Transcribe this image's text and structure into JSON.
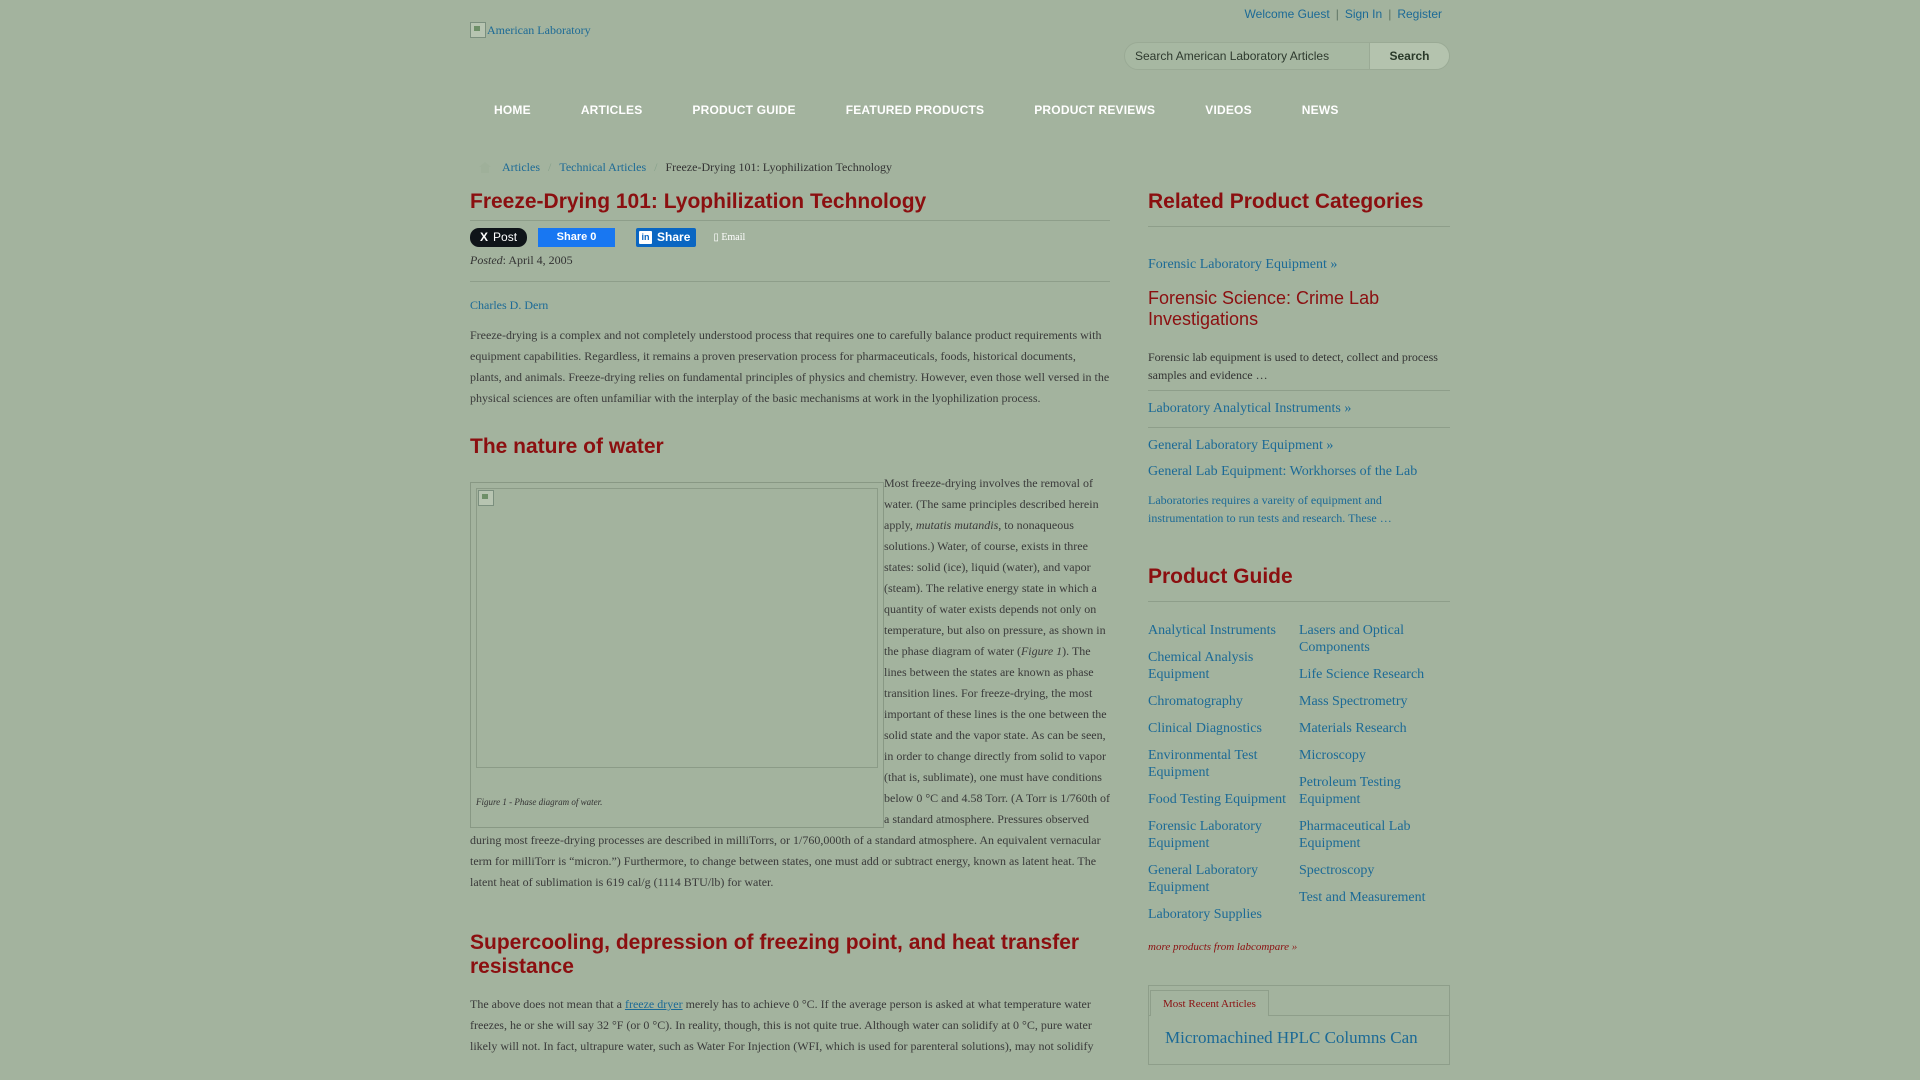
{
  "header": {
    "welcome": "Welcome Guest",
    "sign_in": "Sign In",
    "register": "Register",
    "logo_alt": "American Laboratory",
    "search_placeholder": "Search American Laboratory Articles",
    "search_button": "Search"
  },
  "nav": [
    "HOME",
    "ARTICLES",
    "PRODUCT GUIDE",
    "FEATURED PRODUCTS",
    "PRODUCT REVIEWS",
    "VIDEOS",
    "NEWS"
  ],
  "breadcrumb": {
    "items": [
      "Articles",
      "Technical Articles"
    ],
    "current": "Freeze-Drying 101: Lyophilization Technology"
  },
  "article": {
    "title": "Freeze-Drying 101: Lyophilization Technology",
    "share": {
      "x_post": "Post",
      "fb_share": "Share 0",
      "li_share": "Share",
      "email": "Email"
    },
    "posted_label": "Posted",
    "posted_date": ": April 4, 2005",
    "author": "Charles D. Dern",
    "intro": "Freeze-drying is a complex and not completely understood process that requires one to carefully balance product requirements with equipment capabilities. Regardless, it remains a proven preservation process for pharmaceuticals, foods, historical documents, plants, and animals. Freeze-drying relies on fundamental principles of physics and chemistry. However, even those well versed in the physical sciences are often unfamiliar with the interplay of the basic mechanisms at work in the lyophilization process.",
    "section1_heading": "The nature of water",
    "figure_caption": "Figure 1 - Phase diagram of water.",
    "water_p1": "Most freeze-drying involves the removal of water. (The same principles described herein apply, ",
    "water_em1": "mutatis mutandis",
    "water_p2": ", to nonaqueous solutions.) Water, of course, exists in three states: solid (ice), liquid (water), and vapor (steam). The relative energy state in which a quantity of water exists depends not only on temperature, but also on pressure, as shown in the phase diagram of water (",
    "water_em2": "Figure 1",
    "water_p3": "). The lines between the states are known as phase transition lines. For freeze-drying, the most important of these lines is the one between the solid state and the vapor state. As can be seen, in order to change directly from solid to vapor (that is, sublimate), one must have conditions below 0 °C and 4.58 Torr. (A Torr is 1/760th of a standard atmosphere. Pressures observed during most freeze-drying processes are described in milliTorrs, or 1/760,000th of a standard atmosphere. An equivalent vernacular term for milliTorr is “micron.”) Furthermore, to change between states, one must add or subtract energy, known as latent heat. The latent heat of sublimation is 619 cal/g (1114 BTU/lb) for water.",
    "section2_heading": "Supercooling, depression of freezing point, and heat transfer resistance",
    "p3_a": "The above does not mean that a ",
    "p3_link": "freeze dryer",
    "p3_b": " merely has to achieve 0 °C. If the average person is asked at what temperature water freezes, he or she will say 32 °F (or 0 °C). In reality, though, this is not quite true. Although water can solidify at 0 °C, pure water likely will not. In fact, ultrapure water, such as Water For Injection (WFI, which is used for parenteral solutions), may not solidify"
  },
  "sidebar": {
    "related_heading": "Related Product Categories",
    "cat1_link": "Forensic Laboratory Equipment »",
    "feat1_title": "Forensic Science: Crime Lab Investigations",
    "feat1_desc": "Forensic lab equipment is used to detect, collect and process samples and evidence …",
    "cat2_link": "Laboratory Analytical Instruments »",
    "cat3_link": "General Laboratory Equipment »",
    "feat2_title": "General Lab Equipment: Workhorses of the Lab",
    "feat2_desc": "Laboratories requires a vareity of equipment and instrumentation to run tests and research. These …",
    "guide_heading": "Product Guide",
    "guide_left": [
      "Analytical Instruments",
      "Chemical Analysis Equipment",
      "Chromatography",
      "Clinical Diagnostics",
      "Environmental Test Equipment",
      "Food Testing Equipment",
      "Forensic Laboratory Equipment",
      "General Laboratory Equipment",
      "Laboratory Supplies"
    ],
    "guide_right": [
      "Lasers and Optical Components",
      "Life Science Research",
      "Mass Spectrometry",
      "Materials Research",
      "Microscopy",
      "Petroleum Testing Equipment",
      "Pharmaceutical Lab Equipment",
      "Spectroscopy",
      "Test and Measurement"
    ],
    "more_link": "more products from labcompare »",
    "tab_label": "Most Recent Articles",
    "recent_title": "Micromachined HPLC Columns Can"
  },
  "colors": {
    "background": "#a3b39e",
    "heading_red": "#8b0f10",
    "link_blue": "#1c6a96"
  }
}
